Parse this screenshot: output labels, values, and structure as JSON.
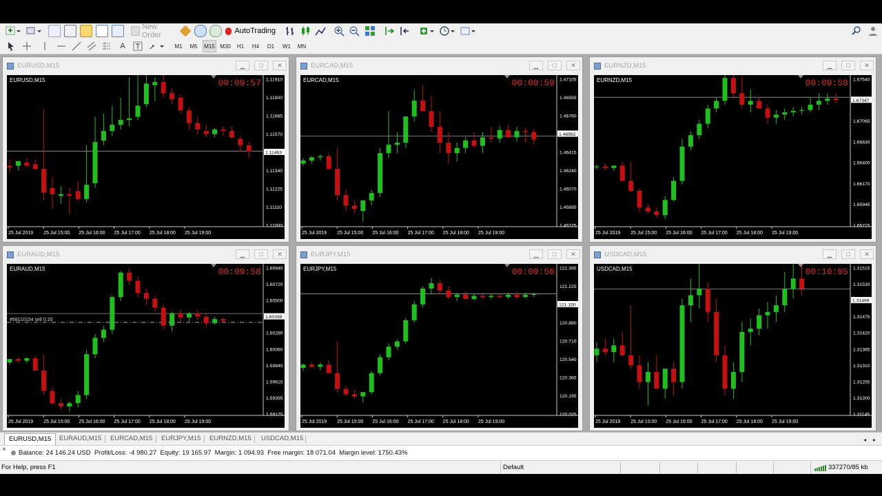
{
  "toolbar": {
    "new_order_label": "New Order",
    "autotrading_label": "AutoTrading"
  },
  "timeframes": [
    "M1",
    "M5",
    "M15",
    "M30",
    "H1",
    "H4",
    "D1",
    "W1",
    "MN"
  ],
  "active_timeframe": "M15",
  "windows": [
    {
      "title": "EURUSD,M15",
      "label": "EURUSD,M15",
      "timer": "00:09:57",
      "prices": [
        "1.11910",
        "1.11800",
        "1.11685",
        "1.11570",
        "1.11463",
        "1.11340",
        "1.11225",
        "1.11110",
        "1.11000"
      ],
      "highlight_index": 4,
      "times": [
        "25 Jul 2019",
        "25 Jul 15:00",
        "25 Jul 16:00",
        "25 Jul 17:00",
        "25 Jul 18:00",
        "25 Jul 19:00"
      ],
      "order_label": "",
      "chart_data": {
        "type": "candlestick",
        "ylim": [
          1.10985,
          1.11935
        ],
        "current": 1.11463,
        "o": [
          1.1137,
          1.1137,
          1.1139,
          1.1138,
          1.1135,
          1.1123,
          1.1118,
          1.1119,
          1.1121,
          1.1116,
          1.1126,
          1.1153,
          1.1159,
          1.1163,
          1.1166,
          1.1168,
          1.1176,
          1.1188,
          1.119,
          1.1183,
          1.118,
          1.1172,
          1.1164,
          1.1159,
          1.1157,
          1.116,
          1.1159,
          1.1154,
          1.115
        ],
        "h": [
          1.1141,
          1.114,
          1.1142,
          1.1141,
          1.1173,
          1.113,
          1.1124,
          1.1123,
          1.1127,
          1.115,
          1.1168,
          1.117,
          1.1175,
          1.118,
          1.1193,
          1.1196,
          1.1198,
          1.1193,
          1.1198,
          1.1186,
          1.1182,
          1.1174,
          1.1168,
          1.1163,
          1.1161,
          1.1162,
          1.1162,
          1.1156,
          1.1152
        ],
        "l": [
          1.1133,
          1.1134,
          1.1136,
          1.1135,
          1.1115,
          1.111,
          1.1113,
          1.1106,
          1.1115,
          1.1114,
          1.1123,
          1.115,
          1.1156,
          1.116,
          1.1162,
          1.1166,
          1.1174,
          1.1178,
          1.118,
          1.1176,
          1.117,
          1.116,
          1.1157,
          1.1155,
          1.1155,
          1.1156,
          1.1154,
          1.1146,
          1.1142
        ],
        "c": [
          1.1136,
          1.114,
          1.1137,
          1.1135,
          1.112,
          1.1119,
          1.1119,
          1.1118,
          1.1116,
          1.1125,
          1.1152,
          1.1159,
          1.1163,
          1.1166,
          1.1167,
          1.1175,
          1.1189,
          1.119,
          1.1183,
          1.1179,
          1.1172,
          1.1164,
          1.116,
          1.1157,
          1.116,
          1.1159,
          1.1155,
          1.115,
          1.1146
        ]
      }
    },
    {
      "title": "EURCAD,M15",
      "label": "EURCAD,M15",
      "timer": "00:09:59",
      "prices": [
        "1.47105",
        "1.46935",
        "1.46760",
        "1.46562",
        "1.46415",
        "1.46240",
        "1.46070",
        "1.45895",
        "1.45725"
      ],
      "highlight_index": 3,
      "times": [
        "25 Jul 2019",
        "25 Jul 15:00",
        "25 Jul 16:00",
        "25 Jul 17:00",
        "25 Jul 18:00",
        "25 Jul 19:00"
      ],
      "order_label": "",
      "chart_data": {
        "type": "candlestick",
        "ylim": [
          1.457,
          1.4713
        ],
        "current": 1.46562,
        "o": [
          1.463,
          1.4633,
          1.4636,
          1.4637,
          1.4625,
          1.46,
          1.459,
          1.4585,
          1.4595,
          1.4602,
          1.464,
          1.4648,
          1.465,
          1.4675,
          1.469,
          1.468,
          1.4665,
          1.465,
          1.464,
          1.4645,
          1.4652,
          1.4647,
          1.4655,
          1.4654,
          1.4662,
          1.4655,
          1.4661,
          1.466
        ],
        "h": [
          1.4635,
          1.4637,
          1.4639,
          1.464,
          1.4645,
          1.4605,
          1.4595,
          1.459,
          1.4605,
          1.4645,
          1.468,
          1.466,
          1.467,
          1.47,
          1.4705,
          1.4695,
          1.468,
          1.466,
          1.465,
          1.4655,
          1.466,
          1.466,
          1.4665,
          1.4666,
          1.4667,
          1.4665,
          1.4664,
          1.4663
        ],
        "l": [
          1.4628,
          1.463,
          1.4633,
          1.4625,
          1.4595,
          1.4585,
          1.4583,
          1.4575,
          1.459,
          1.4598,
          1.4635,
          1.464,
          1.4645,
          1.467,
          1.468,
          1.466,
          1.464,
          1.463,
          1.4632,
          1.464,
          1.4645,
          1.464,
          1.465,
          1.465,
          1.4655,
          1.4651,
          1.465,
          1.4648
        ],
        "c": [
          1.4633,
          1.4636,
          1.4637,
          1.4625,
          1.46,
          1.459,
          1.4587,
          1.4595,
          1.4602,
          1.464,
          1.4648,
          1.465,
          1.4675,
          1.469,
          1.468,
          1.4665,
          1.465,
          1.464,
          1.4645,
          1.4652,
          1.4647,
          1.4655,
          1.4654,
          1.4662,
          1.4655,
          1.4661,
          1.466,
          1.4653
        ]
      }
    },
    {
      "title": "EURNZD,M15",
      "label": "EURNZD,M15",
      "timer": "00:09:58",
      "prices": [
        "1.67540",
        "1.67347",
        "1.67065",
        "1.66630",
        "1.66400",
        "1.66170",
        "1.65945",
        "1.65715"
      ],
      "highlight_index": 1,
      "times": [
        "25 Jul 2019",
        "25 Jul 15:00",
        "25 Jul 16:00",
        "25 Jul 17:00",
        "25 Jul 18:00",
        "25 Jul 19:00"
      ],
      "order_label": "",
      "chart_data": {
        "type": "candlestick",
        "ylim": [
          1.6565,
          1.6762
        ],
        "current": 1.67347,
        "o": [
          1.6643,
          1.6644,
          1.6642,
          1.6645,
          1.6625,
          1.6612,
          1.659,
          1.6585,
          1.658,
          1.66,
          1.6625,
          1.667,
          1.6685,
          1.67,
          1.672,
          1.673,
          1.676,
          1.674,
          1.6725,
          1.673,
          1.672,
          1.6708,
          1.6712,
          1.6715,
          1.6717,
          1.6718,
          1.6725,
          1.673,
          1.6733
        ],
        "h": [
          1.6647,
          1.6648,
          1.6646,
          1.665,
          1.665,
          1.6615,
          1.6595,
          1.659,
          1.6605,
          1.663,
          1.668,
          1.669,
          1.6705,
          1.6725,
          1.6735,
          1.677,
          1.6775,
          1.6762,
          1.6745,
          1.6735,
          1.6725,
          1.6718,
          1.672,
          1.6722,
          1.6722,
          1.6735,
          1.674,
          1.674,
          1.674
        ],
        "l": [
          1.664,
          1.664,
          1.6638,
          1.6642,
          1.661,
          1.6585,
          1.6582,
          1.6577,
          1.6575,
          1.6598,
          1.662,
          1.6665,
          1.668,
          1.6695,
          1.6715,
          1.6725,
          1.6735,
          1.672,
          1.6715,
          1.672,
          1.67,
          1.67,
          1.6705,
          1.671,
          1.6712,
          1.6715,
          1.6718,
          1.6725,
          1.6727
        ],
        "c": [
          1.6644,
          1.6642,
          1.6645,
          1.6625,
          1.6612,
          1.659,
          1.6585,
          1.658,
          1.66,
          1.6625,
          1.667,
          1.6685,
          1.67,
          1.672,
          1.673,
          1.676,
          1.674,
          1.6725,
          1.673,
          1.672,
          1.6708,
          1.6712,
          1.6715,
          1.6717,
          1.6718,
          1.6725,
          1.673,
          1.6733,
          1.6731
        ]
      }
    },
    {
      "title": "EURAUD,M15",
      "label": "EURAUD,M15",
      "timer": "00:09:58",
      "prices": [
        "1.60940",
        "1.60720",
        "1.60500",
        "1.60398",
        "1.60280",
        "1.60060",
        "1.59840",
        "1.59615",
        "1.59395",
        "1.59175"
      ],
      "highlight_index": 3,
      "times": [
        "25 Jul 2019",
        "25 Jul 15:00",
        "25 Jul 16:00",
        "25 Jul 17:00",
        "25 Jul 18:00",
        "25 Jul 19:00"
      ],
      "order_label": "#68110154 sell 0.20",
      "order_price": 1.6029,
      "chart_data": {
        "type": "candlestick",
        "ylim": [
          1.5915,
          1.6099
        ],
        "current": 1.60398,
        "o": [
          1.598,
          1.5984,
          1.5982,
          1.5985,
          1.597,
          1.5945,
          1.593,
          1.5926,
          1.593,
          1.594,
          1.599,
          1.601,
          1.602,
          1.606,
          1.609,
          1.608,
          1.6065,
          1.6058,
          1.6047,
          1.6025,
          1.604,
          1.6035,
          1.604,
          1.6036,
          1.6028,
          1.6033
        ],
        "h": [
          1.5984,
          1.5986,
          1.5986,
          1.5988,
          1.599,
          1.595,
          1.5935,
          1.5932,
          1.5945,
          1.5995,
          1.6015,
          1.6025,
          1.6062,
          1.6092,
          1.6095,
          1.6085,
          1.607,
          1.6062,
          1.605,
          1.6042,
          1.6045,
          1.6042,
          1.6043,
          1.604,
          1.6036,
          1.6035
        ],
        "l": [
          1.5977,
          1.598,
          1.5979,
          1.5982,
          1.594,
          1.5928,
          1.5922,
          1.592,
          1.5925,
          1.5935,
          1.5985,
          1.6005,
          1.6015,
          1.6055,
          1.6075,
          1.606,
          1.605,
          1.6042,
          1.602,
          1.6018,
          1.603,
          1.603,
          1.6032,
          1.6024,
          1.6026,
          1.6028
        ],
        "c": [
          1.5984,
          1.5982,
          1.5985,
          1.597,
          1.5945,
          1.593,
          1.5926,
          1.593,
          1.594,
          1.599,
          1.601,
          1.602,
          1.606,
          1.609,
          1.608,
          1.6065,
          1.6058,
          1.6047,
          1.6025,
          1.604,
          1.6035,
          1.604,
          1.6036,
          1.6028,
          1.6033,
          1.6031
        ]
      }
    },
    {
      "title": "EURJPY,M15",
      "label": "EURJPY,M15",
      "timer": "00:09:56",
      "prices": [
        "121.395",
        "121.225",
        "121.150",
        "120.880",
        "120.710",
        "120.540",
        "120.365",
        "120.195",
        "120.025"
      ],
      "highlight_index": 2,
      "times": [
        "25 Jul 2019",
        "25 Jul 15:00",
        "25 Jul 16:00",
        "25 Jul 17:00",
        "25 Jul 18:00",
        "25 Jul 19:00"
      ],
      "order_label": "",
      "chart_data": {
        "type": "candlestick",
        "ylim": [
          120.0,
          121.42
        ],
        "current": 121.15,
        "o": [
          120.45,
          120.48,
          120.46,
          120.48,
          120.4,
          120.25,
          120.2,
          120.18,
          120.22,
          120.4,
          120.55,
          120.65,
          120.7,
          120.9,
          121.05,
          121.2,
          121.25,
          121.18,
          121.12,
          121.14,
          121.1,
          121.13,
          121.12,
          121.13,
          121.12,
          121.14,
          121.12,
          121.14
        ],
        "h": [
          120.49,
          120.5,
          120.5,
          120.52,
          120.7,
          120.28,
          120.24,
          120.22,
          120.42,
          120.58,
          120.68,
          120.72,
          120.92,
          121.08,
          121.22,
          121.3,
          121.28,
          121.22,
          121.16,
          121.17,
          121.15,
          121.16,
          121.15,
          121.16,
          121.16,
          121.17,
          121.16,
          121.16
        ],
        "l": [
          120.42,
          120.45,
          120.43,
          120.44,
          120.22,
          120.18,
          120.16,
          120.12,
          120.2,
          120.38,
          120.52,
          120.62,
          120.68,
          120.88,
          121.02,
          121.15,
          121.15,
          121.1,
          121.08,
          121.1,
          121.09,
          121.1,
          121.1,
          121.11,
          121.1,
          121.1,
          121.11,
          121.12
        ],
        "c": [
          120.48,
          120.46,
          120.48,
          120.4,
          120.25,
          120.2,
          120.18,
          120.22,
          120.4,
          120.55,
          120.65,
          120.7,
          120.9,
          121.05,
          121.2,
          121.25,
          121.18,
          121.12,
          121.14,
          121.1,
          121.13,
          121.12,
          121.13,
          121.12,
          121.14,
          121.12,
          121.14,
          121.15
        ]
      }
    },
    {
      "title": "USDCAD,M15",
      "label": "USDCAD,M15",
      "timer": "00:10:05",
      "prices": [
        "1.31515",
        "1.31530",
        "1.31499",
        "1.31475",
        "1.31420",
        "1.31365",
        "1.31310",
        "1.31255",
        "1.31200",
        "1.31145"
      ],
      "highlight_index": 2,
      "times": [
        "25 Jul 2019",
        "25 Jul 15:00",
        "25 Jul 16:00",
        "25 Jul 17:00",
        "25 Jul 18:00",
        "25 Jul 19:00"
      ],
      "order_label": "",
      "chart_data": {
        "type": "candlestick",
        "ylim": [
          1.3112,
          1.3157
        ],
        "current": 1.31499,
        "o": [
          1.313,
          1.3132,
          1.3131,
          1.3133,
          1.313,
          1.3127,
          1.3122,
          1.3125,
          1.312,
          1.3126,
          1.3122,
          1.3145,
          1.3148,
          1.315,
          1.3143,
          1.313,
          1.312,
          1.3125,
          1.3137,
          1.3138,
          1.3142,
          1.3143,
          1.3145,
          1.315,
          1.3153
        ],
        "h": [
          1.3134,
          1.3135,
          1.3135,
          1.3137,
          1.3145,
          1.313,
          1.3128,
          1.313,
          1.3125,
          1.3128,
          1.3147,
          1.3153,
          1.316,
          1.3152,
          1.3147,
          1.3133,
          1.3128,
          1.314,
          1.3141,
          1.3144,
          1.3146,
          1.3148,
          1.3155,
          1.3163,
          1.3158
        ],
        "l": [
          1.3128,
          1.313,
          1.3128,
          1.313,
          1.3126,
          1.312,
          1.3115,
          1.312,
          1.3117,
          1.3118,
          1.312,
          1.314,
          1.3144,
          1.314,
          1.3128,
          1.3118,
          1.3117,
          1.3122,
          1.3133,
          1.3136,
          1.3138,
          1.314,
          1.3143,
          1.3147,
          1.3148
        ],
        "c": [
          1.3132,
          1.3131,
          1.3133,
          1.313,
          1.3127,
          1.3122,
          1.3125,
          1.312,
          1.3126,
          1.3122,
          1.3145,
          1.3148,
          1.315,
          1.3143,
          1.313,
          1.312,
          1.3125,
          1.3137,
          1.3138,
          1.3142,
          1.3143,
          1.3145,
          1.315,
          1.3153,
          1.315
        ]
      }
    }
  ],
  "tabs": [
    "EURUSD,M15",
    "EURAUD,M15",
    "EURCAD,M15",
    "EURJPY,M15",
    "EURNZD,M15",
    "USDCAD,M15"
  ],
  "terminal": {
    "close_symbol": "×",
    "balance_text": "Balance: 24 146.24 USD  Profit/Loss: -4 980.27  Equity: 19 165.97  Margin: 1 094.93  Free margin: 18 071.04  Margin level: 1750.43%"
  },
  "status": {
    "help": "For Help, press F1",
    "profile": "Default",
    "connection": "337270/85 kb"
  },
  "colors": {
    "bull": "#1fbf1f",
    "bear": "#c41010",
    "timer": "#e0261b"
  }
}
